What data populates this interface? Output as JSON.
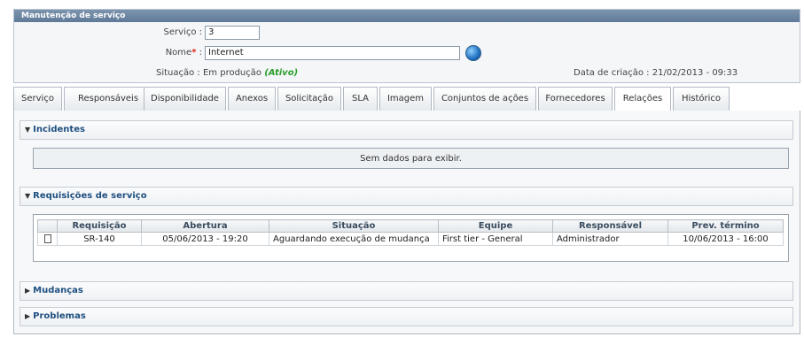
{
  "window": {
    "title": "Manutenção de serviço"
  },
  "form": {
    "servico_label": "Serviço :",
    "servico_value": "3",
    "nome_label": "Nome",
    "nome_required": "*",
    "nome_colon": ":",
    "nome_value": "Internet",
    "situacao_label": "Situação : Em produção",
    "situacao_status": "(Ativo)",
    "data_criacao": "Data de criação : 21/02/2013 - 09:33",
    "lookup_icon": "globe-icon"
  },
  "tabs": [
    {
      "label": "Serviço"
    },
    {
      "label": "Responsáveis"
    },
    {
      "label": "Disponibilidade"
    },
    {
      "label": "Anexos"
    },
    {
      "label": "Solicitação"
    },
    {
      "label": "SLA"
    },
    {
      "label": "Imagem"
    },
    {
      "label": "Conjuntos de ações"
    },
    {
      "label": "Fornecedores"
    },
    {
      "label": "Relações"
    },
    {
      "label": "Histórico"
    }
  ],
  "active_tab": "Relações",
  "sections": {
    "incidentes": {
      "title": "Incidentes",
      "expanded": true,
      "empty_text": "Sem dados para exibir."
    },
    "requisicoes": {
      "title": "Requisições de serviço",
      "expanded": true,
      "columns": [
        "Requisição",
        "Abertura",
        "Situação",
        "Equipe",
        "Responsável",
        "Prev. término"
      ],
      "rows": [
        {
          "icon": "document-icon",
          "requisicao": "SR-140",
          "abertura": "05/06/2013 - 19:20",
          "situacao": "Aguardando execução de mudança",
          "equipe": "First tier - General",
          "responsavel": "Administrador",
          "prev_termino": "10/06/2013 - 16:00"
        }
      ]
    },
    "mudancas": {
      "title": "Mudanças",
      "expanded": false
    },
    "problemas": {
      "title": "Problemas",
      "expanded": false
    }
  },
  "colors": {
    "titlebar": "#6a86a4",
    "section_title": "#1f4f7f",
    "active_status": "#2a9d2a"
  }
}
